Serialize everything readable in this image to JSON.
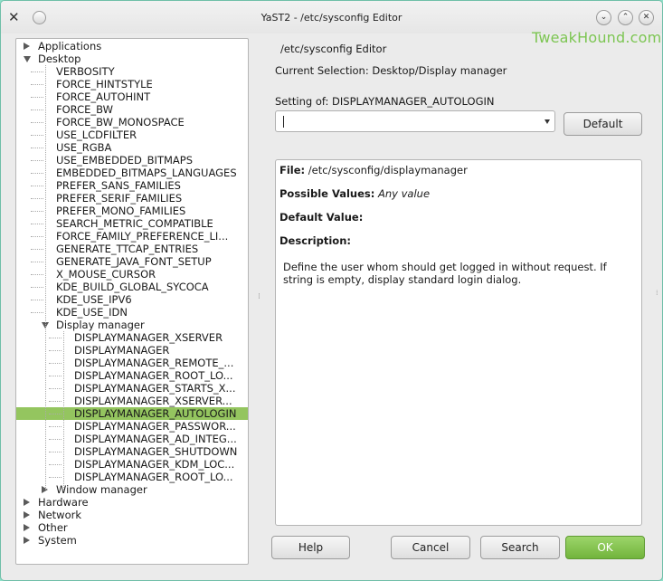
{
  "window": {
    "title": "YaST2 - /etc/sysconfig Editor",
    "app_icon": "yast-icon"
  },
  "watermark": "TweakHound.com",
  "tree": {
    "rows": [
      {
        "label": "Applications",
        "level": 0,
        "expander": "collapsed"
      },
      {
        "label": "Desktop",
        "level": 0,
        "expander": "expanded"
      },
      {
        "label": "VERBOSITY",
        "level": 1
      },
      {
        "label": "FORCE_HINTSTYLE",
        "level": 1
      },
      {
        "label": "FORCE_AUTOHINT",
        "level": 1
      },
      {
        "label": "FORCE_BW",
        "level": 1
      },
      {
        "label": "FORCE_BW_MONOSPACE",
        "level": 1
      },
      {
        "label": "USE_LCDFILTER",
        "level": 1
      },
      {
        "label": "USE_RGBA",
        "level": 1
      },
      {
        "label": "USE_EMBEDDED_BITMAPS",
        "level": 1
      },
      {
        "label": "EMBEDDED_BITMAPS_LANGUAGES",
        "level": 1
      },
      {
        "label": "PREFER_SANS_FAMILIES",
        "level": 1
      },
      {
        "label": "PREFER_SERIF_FAMILIES",
        "level": 1
      },
      {
        "label": "PREFER_MONO_FAMILIES",
        "level": 1
      },
      {
        "label": "SEARCH_METRIC_COMPATIBLE",
        "level": 1
      },
      {
        "label": "FORCE_FAMILY_PREFERENCE_LI...",
        "level": 1
      },
      {
        "label": "GENERATE_TTCAP_ENTRIES",
        "level": 1
      },
      {
        "label": "GENERATE_JAVA_FONT_SETUP",
        "level": 1
      },
      {
        "label": "X_MOUSE_CURSOR",
        "level": 1
      },
      {
        "label": "KDE_BUILD_GLOBAL_SYCOCA",
        "level": 1
      },
      {
        "label": "KDE_USE_IPV6",
        "level": 1
      },
      {
        "label": "KDE_USE_IDN",
        "level": 1
      },
      {
        "label": "Display manager",
        "level": 1,
        "expander": "expanded"
      },
      {
        "label": "DISPLAYMANAGER_XSERVER",
        "level": 2
      },
      {
        "label": "DISPLAYMANAGER",
        "level": 2
      },
      {
        "label": "DISPLAYMANAGER_REMOTE_...",
        "level": 2
      },
      {
        "label": "DISPLAYMANAGER_ROOT_LO...",
        "level": 2
      },
      {
        "label": "DISPLAYMANAGER_STARTS_X...",
        "level": 2
      },
      {
        "label": "DISPLAYMANAGER_XSERVER...",
        "level": 2
      },
      {
        "label": "DISPLAYMANAGER_AUTOLOGIN",
        "level": 2,
        "selected": true
      },
      {
        "label": "DISPLAYMANAGER_PASSWOR...",
        "level": 2
      },
      {
        "label": "DISPLAYMANAGER_AD_INTEG...",
        "level": 2
      },
      {
        "label": "DISPLAYMANAGER_SHUTDOWN",
        "level": 2
      },
      {
        "label": "DISPLAYMANAGER_KDM_LOC...",
        "level": 2
      },
      {
        "label": "DISPLAYMANAGER_ROOT_LO...",
        "level": 2
      },
      {
        "label": "Window manager",
        "level": 1,
        "expander": "collapsed"
      },
      {
        "label": "Hardware",
        "level": 0,
        "expander": "collapsed"
      },
      {
        "label": "Network",
        "level": 0,
        "expander": "collapsed"
      },
      {
        "label": "Other",
        "level": 0,
        "expander": "collapsed"
      },
      {
        "label": "System",
        "level": 0,
        "expander": "collapsed"
      }
    ]
  },
  "editor": {
    "heading": "/etc/sysconfig Editor",
    "current_selection": "Current Selection: Desktop/Display manager",
    "setting_label": "Setting of: DISPLAYMANAGER_AUTOLOGIN",
    "setting_value": "",
    "default_button": "Default"
  },
  "info": {
    "file_label": "File:",
    "file_value": "/etc/sysconfig/displaymanager",
    "possible_label": "Possible Values:",
    "possible_value": "Any value",
    "default_label": "Default Value:",
    "default_value": "",
    "description_label": "Description:",
    "description_text": "Define the user whom should get logged in without request. If string is empty, display standard login dialog."
  },
  "buttons": {
    "help": "Help",
    "cancel": "Cancel",
    "search": "Search",
    "ok": "OK"
  },
  "colors": {
    "selection": "#94c55f",
    "ok_button": "#7fbf45",
    "background": "#8ee0c9",
    "watermark": "#7cc552"
  }
}
